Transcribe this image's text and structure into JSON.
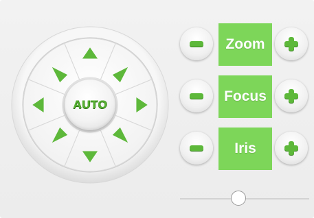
{
  "ptz": {
    "center_label": "AUTO",
    "directions": [
      "up",
      "up-right",
      "right",
      "down-right",
      "down",
      "down-left",
      "left",
      "up-left"
    ],
    "arrow_color": "#5db83a"
  },
  "controls": [
    {
      "id": "zoom",
      "label": "Zoom",
      "minus_icon": "minus-icon",
      "plus_icon": "plus-icon"
    },
    {
      "id": "focus",
      "label": "Focus",
      "minus_icon": "minus-icon",
      "plus_icon": "plus-icon"
    },
    {
      "id": "iris",
      "label": "Iris",
      "minus_icon": "minus-icon",
      "plus_icon": "plus-icon"
    }
  ],
  "colors": {
    "label_bg": "#7dd659",
    "accent": "#5db83a"
  },
  "slider": {
    "value_fraction": 0.45
  }
}
